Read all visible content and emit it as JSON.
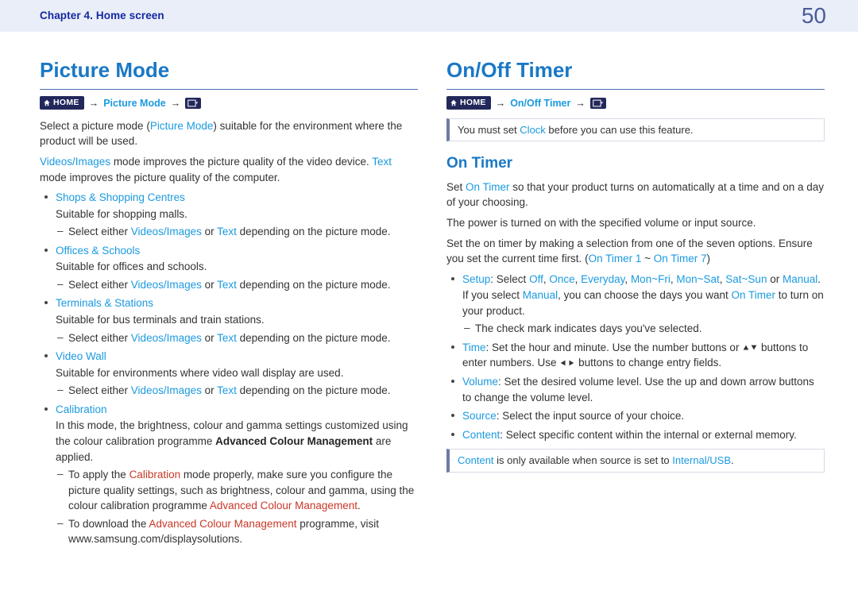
{
  "header": {
    "chapter": "Chapter 4. Home screen",
    "page": "50"
  },
  "left": {
    "title": "Picture Mode",
    "breadcrumb": {
      "home": "HOME",
      "item": "Picture Mode"
    },
    "p1_a": "Select a picture mode (",
    "p1_b": "Picture Mode",
    "p1_c": ") suitable for the environment where the product will be used.",
    "p2_a": "Videos/Images",
    "p2_b": " mode improves the picture quality of the video device. ",
    "p2_c": "Text",
    "p2_d": " mode improves the picture quality of the computer.",
    "items": [
      {
        "name": "Shops & Shopping Centres",
        "desc": "Suitable for shopping malls.",
        "sub_a": "Select either ",
        "sub_b": "Videos/Images",
        "sub_c": " or ",
        "sub_d": "Text",
        "sub_e": " depending on the picture mode."
      },
      {
        "name": "Offices & Schools",
        "desc": "Suitable for offices and schools.",
        "sub_a": "Select either ",
        "sub_b": "Videos/Images",
        "sub_c": " or ",
        "sub_d": "Text",
        "sub_e": " depending on the picture mode."
      },
      {
        "name": "Terminals & Stations",
        "desc": "Suitable for bus terminals and train stations.",
        "sub_a": "Select either ",
        "sub_b": "Videos/Images",
        "sub_c": " or ",
        "sub_d": "Text",
        "sub_e": " depending on the picture mode."
      },
      {
        "name": "Video Wall",
        "desc": "Suitable for environments where video wall display are used.",
        "sub_a": "Select either ",
        "sub_b": "Videos/Images",
        "sub_c": " or ",
        "sub_d": "Text",
        "sub_e": " depending on the picture mode."
      }
    ],
    "calib": {
      "name": "Calibration",
      "desc_a": "In this mode, the brightness, colour and gamma settings customized using the colour calibration programme ",
      "desc_b": "Advanced Colour Management",
      "desc_c": " are applied.",
      "d1_a": "To apply the ",
      "d1_b": "Calibration",
      "d1_c": " mode properly, make sure you configure the picture quality settings, such as brightness, colour and gamma, using the colour calibration programme ",
      "d1_d": "Advanced Colour Management",
      "d1_e": ".",
      "d2_a": "To download the ",
      "d2_b": "Advanced Colour Management",
      "d2_c": " programme, visit www.samsung.com/displaysolutions."
    }
  },
  "right": {
    "title": "On/Off Timer",
    "breadcrumb": {
      "home": "HOME",
      "item": "On/Off Timer"
    },
    "note1_a": "You must set ",
    "note1_b": "Clock",
    "note1_c": " before you can use this feature.",
    "subTitle": "On Timer",
    "p1_a": "Set ",
    "p1_b": "On Timer",
    "p1_c": " so that your product turns on automatically at a time and on a day of your choosing.",
    "p2": "The power is turned on with the specified volume or input source.",
    "p3_a": "Set the on timer by making a selection from one of the seven options. Ensure you set the current time first. (",
    "p3_b": "On Timer 1",
    "p3_c": " ~ ",
    "p3_d": "On Timer 7",
    "p3_e": ")",
    "setup": {
      "label": "Setup",
      "prefix": ": Select ",
      "opts": [
        "Off",
        "Once",
        "Everyday",
        "Mon~Fri",
        "Mon~Sat",
        "Sat~Sun",
        "Manual"
      ],
      "or": " or ",
      "sep": ", ",
      "suffix": ".",
      "line2_a": "If you select ",
      "line2_b": "Manual",
      "line2_c": ", you can choose the days you want ",
      "line2_d": "On Timer",
      "line2_e": " to turn on your product.",
      "dash": "The check mark indicates days you've selected."
    },
    "time": {
      "label": "Time",
      "a": ": Set the hour and minute. Use the number buttons or ",
      "b": " buttons to enter numbers. Use ",
      "c": " buttons to change entry fields."
    },
    "volume": {
      "label": "Volume",
      "t": ": Set the desired volume level. Use the up and down arrow buttons to change the volume level."
    },
    "source": {
      "label": "Source",
      "t": ": Select the input source of your choice."
    },
    "content": {
      "label": "Content",
      "t": ": Select specific content within the internal or external memory."
    },
    "note2_a": "Content",
    "note2_b": " is only available when source is set to ",
    "note2_c": "Internal/USB",
    "note2_d": "."
  }
}
